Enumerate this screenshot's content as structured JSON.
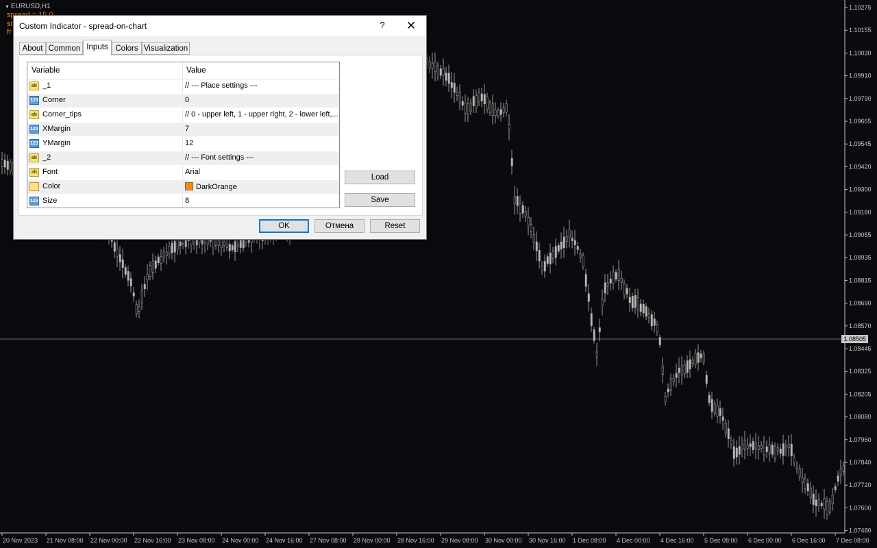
{
  "chart": {
    "title": "EURUSD,H1",
    "indicator_lines": [
      "spread = 15.0",
      "st",
      "fr"
    ],
    "current_price": "1.08505",
    "price_labels": [
      "1.10275",
      "1.10155",
      "1.10030",
      "1.09910",
      "1.09790",
      "1.09665",
      "1.09545",
      "1.09420",
      "1.09300",
      "1.09180",
      "1.09055",
      "1.08935",
      "1.08815",
      "1.08690",
      "1.08570",
      "1.08445",
      "1.08325",
      "1.08205",
      "1.08080",
      "1.07960",
      "1.07840",
      "1.07720",
      "1.07600",
      "1.07480"
    ],
    "time_labels": [
      "20 Nov 2023",
      "21 Nov 08:00",
      "22 Nov 00:00",
      "22 Nov 16:00",
      "23 Nov 08:00",
      "24 Nov 00:00",
      "24 Nov 16:00",
      "27 Nov 08:00",
      "28 Nov 00:00",
      "28 Nov 16:00",
      "29 Nov 08:00",
      "30 Nov 00:00",
      "30 Nov 16:00",
      "1 Dec 08:00",
      "4 Dec 00:00",
      "4 Dec 16:00",
      "5 Dec 08:00",
      "6 Dec 00:00",
      "6 Dec 16:00",
      "7 Dec 08:00"
    ],
    "colors": {
      "background": "#0b0b0f",
      "candle": "#c8c8c8",
      "axis_text": "#c8c8c8",
      "indicator": "#ff8c00"
    }
  },
  "dialog": {
    "title": "Custom Indicator - spread-on-chart",
    "help_label": "?",
    "close_label": "✕",
    "tabs": [
      "About",
      "Common",
      "Inputs",
      "Colors",
      "Visualization"
    ],
    "active_tab": "Inputs",
    "columns": {
      "variable": "Variable",
      "value": "Value"
    },
    "rows": [
      {
        "type": "ab",
        "variable": "_1",
        "value": "// --- Place settings ---"
      },
      {
        "type": "123",
        "variable": "Corner",
        "value": "0"
      },
      {
        "type": "ab",
        "variable": "Corner_tips",
        "value": "// 0 - upper left, 1 - upper right, 2 - lower left,..."
      },
      {
        "type": "123",
        "variable": "XMargin",
        "value": "7"
      },
      {
        "type": "123",
        "variable": "YMargin",
        "value": "12"
      },
      {
        "type": "ab",
        "variable": "_2",
        "value": "// --- Font settings ---"
      },
      {
        "type": "ab",
        "variable": "Font",
        "value": "Arial"
      },
      {
        "type": "color",
        "variable": "Color",
        "value": "DarkOrange",
        "swatch": "#ff8c00"
      },
      {
        "type": "123",
        "variable": "Size",
        "value": "8"
      }
    ],
    "load_label": "Load",
    "save_label": "Save",
    "ok_label": "OK",
    "cancel_label": "Отмена",
    "reset_label": "Reset"
  }
}
